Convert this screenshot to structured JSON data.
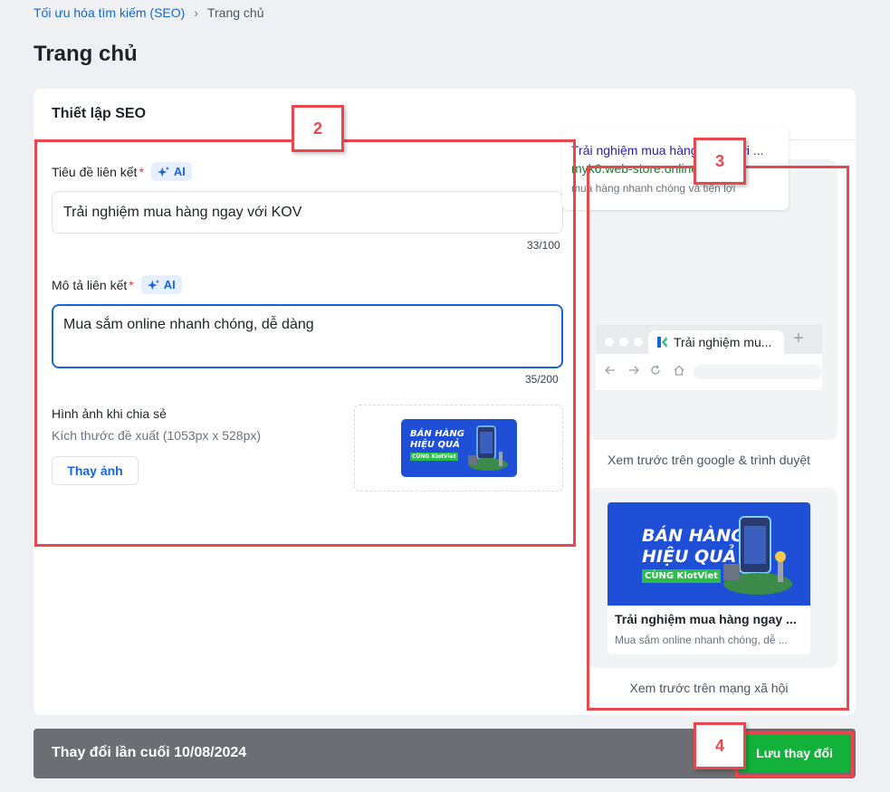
{
  "breadcrumb": {
    "parent": "Tối ưu hóa tìm kiếm (SEO)",
    "separator": "›",
    "current": "Trang chủ"
  },
  "page": {
    "title": "Trang chủ"
  },
  "card": {
    "title": "Thiết lập SEO"
  },
  "form": {
    "link_title": {
      "label": "Tiêu đề liên kết",
      "required": "*",
      "ai_label": "AI",
      "value": "Trải nghiệm mua hàng ngay với KOV",
      "counter": "33/100"
    },
    "link_desc": {
      "label": "Mô tả liên kết",
      "required": "*",
      "ai_label": "AI",
      "value": "Mua sắm online nhanh chóng, dễ dàng",
      "counter": "35/200"
    },
    "share_image": {
      "label": "Hình ảnh khi chia sẻ",
      "hint": "Kích thước đề xuất (1053px x 528px)",
      "change_button": "Thay ảnh"
    }
  },
  "banner": {
    "line1": "BÁN HÀNG",
    "line2": "HIỆU QUẢ",
    "line3": "CÙNG",
    "brand": "KiotViet"
  },
  "preview": {
    "google": {
      "title": "Trải nghiệm mua hàng ngay với ...",
      "url": "myk6.web-store.online",
      "desc": "mua hàng nhanh chóng và tiện lợi"
    },
    "browser": {
      "tab_title": "Trải nghiệm mu...",
      "plus": "+"
    },
    "caption_google": "Xem trước trên google & trình duyệt",
    "social": {
      "title": "Trải nghiệm mua hàng ngay ...",
      "desc": "Mua sắm online nhanh chóng, dễ ..."
    },
    "caption_social": "Xem trước trên mạng xã hội"
  },
  "footer": {
    "last_changed": "Thay đổi lần cuối 10/08/2024",
    "save_button": "Lưu thay đổi"
  },
  "annotations": {
    "m2": "2",
    "m3": "3",
    "m4": "4"
  },
  "colors": {
    "primary": "#1766d6",
    "success": "#12b23a",
    "annotation": "#e8484d"
  },
  "icons": {
    "ai": "sparkle-icon",
    "back": "arrow-left-icon",
    "forward": "arrow-right-icon",
    "reload": "reload-icon",
    "home": "home-icon"
  }
}
